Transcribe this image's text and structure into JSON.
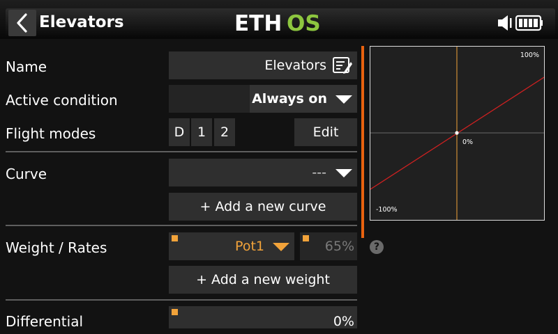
{
  "header": {
    "title": "Elevators",
    "logo_left": "ETH",
    "logo_right": "OS"
  },
  "form": {
    "name": {
      "label": "Name",
      "value": "Elevators"
    },
    "active_condition": {
      "label": "Active condition",
      "value": "Always on"
    },
    "flight_modes": {
      "label": "Flight modes",
      "modes": [
        "D",
        "1",
        "2"
      ],
      "edit_label": "Edit"
    },
    "curve": {
      "label": "Curve",
      "value": "---",
      "add_label": "+ Add a new curve"
    },
    "weight": {
      "label": "Weight / Rates",
      "source": "Pot1",
      "value": "65%",
      "add_label": "+ Add a new weight"
    },
    "differential": {
      "label": "Differential",
      "value": "0%"
    }
  },
  "graph": {
    "top_label": "100%",
    "center_label": "0%",
    "bottom_label": "-100%",
    "curve_color": "#d02020",
    "axis_color": "#f2a33a"
  },
  "help": {
    "glyph": "?"
  },
  "colors": {
    "accent": "#e8620f",
    "source": "#f2a33a",
    "logo_green": "#8dc63f"
  }
}
